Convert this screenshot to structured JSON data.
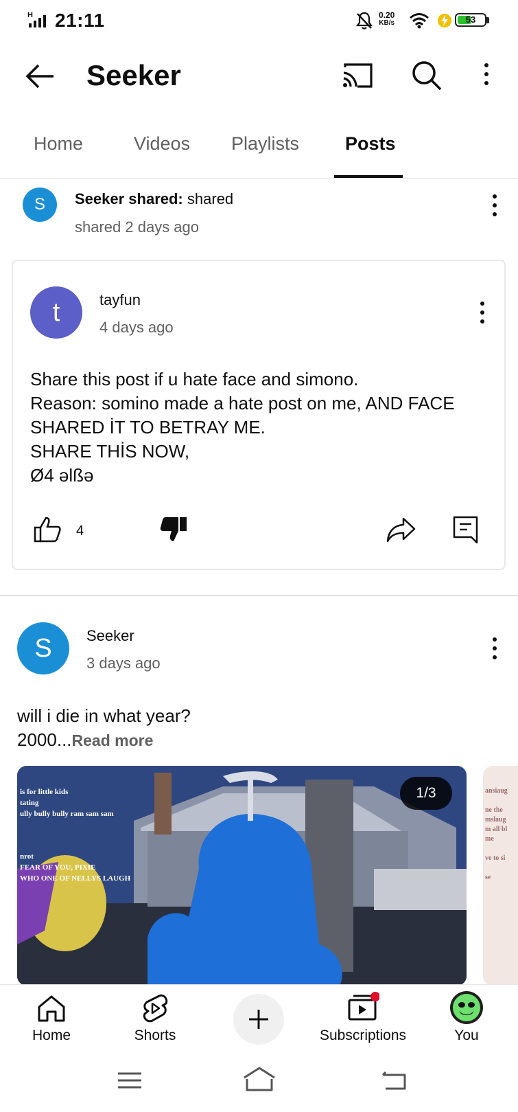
{
  "status_bar": {
    "network_letter": "H",
    "time": "21:11",
    "speed_value": "0.20",
    "speed_unit": "KB/s",
    "battery": "53",
    "battery_level": 0.53
  },
  "header": {
    "title": "Seeker"
  },
  "tabs": [
    {
      "label": "Home"
    },
    {
      "label": "Videos"
    },
    {
      "label": "Playlists"
    },
    {
      "label": "Posts",
      "active": true
    }
  ],
  "shared_post": {
    "avatar_letter": "S",
    "author": "Seeker shared:",
    "action": "shared",
    "meta": "shared 2 days ago"
  },
  "inner_post": {
    "avatar_letter": "t",
    "author": "tayfun",
    "time": "4 days ago",
    "body": "Share this post if u hate face and simono.\nReason: somino made a hate post on me, AND FACE SHARED İT TO BETRAY ME.\nSHARE THİS NOW,\nØ4 əlßə",
    "likes": "4"
  },
  "second_post": {
    "avatar_letter": "S",
    "author": "Seeker",
    "time": "3 days ago",
    "body": "will i die in what year?\n2000",
    "ellipsis": "...",
    "read_more": "Read more",
    "pager": "1/3",
    "image_text": {
      "top": "is for little kids\ntating\nully bully bully ram sam sam",
      "mid": "nrot\nFEAR OF YOU, PIXIE\nWHO ONE OF NELLYS LAUGH",
      "side": "ansiaug\n\nne the\nmslaug\nm all bl\nme\n\nve to si\n\nse"
    }
  },
  "bottom_nav": [
    {
      "label": "Home",
      "icon": "home-icon"
    },
    {
      "label": "Shorts",
      "icon": "shorts-icon"
    },
    {
      "label": "",
      "icon": "plus-icon"
    },
    {
      "label": "Subscriptions",
      "icon": "subscriptions-icon"
    },
    {
      "label": "You",
      "icon": "you-avatar"
    }
  ],
  "colors": {
    "seeker_avatar": "#1a8fd6",
    "tayfun_avatar": "#5b5fc7",
    "notification_dot": "#e0102c",
    "charging": "#f2c100",
    "battery_fill": "#2ec12e"
  }
}
